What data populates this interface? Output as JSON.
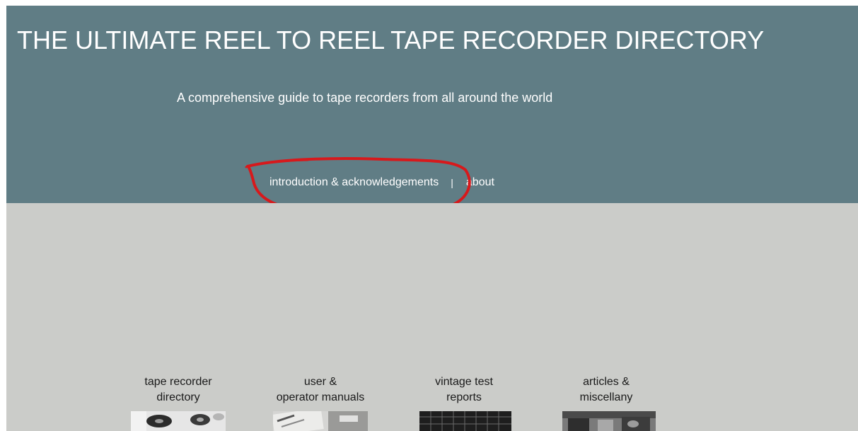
{
  "header": {
    "title": "THE ULTIMATE REEL TO REEL TAPE RECORDER DIRECTORY",
    "tagline": "A comprehensive guide to tape recorders from all around the world",
    "background_color": "#607d85"
  },
  "nav": {
    "items": [
      {
        "label": "introduction & acknowledgements"
      },
      {
        "label": "about"
      }
    ],
    "separator": "|"
  },
  "annotation": {
    "color": "#d7191c",
    "icon": "hand-drawn-circle"
  },
  "content": {
    "background_color": "#cbccc9",
    "tiles": [
      {
        "label": "tape recorder\ndirectory",
        "thumb_icon": "tape-reel-photo-thumbnail"
      },
      {
        "label": "user &\noperator manuals",
        "thumb_icon": "akai-manual-cover-thumbnail"
      },
      {
        "label": "vintage test\nreports",
        "thumb_icon": "test-report-grid-thumbnail"
      },
      {
        "label": "articles &\nmiscellany",
        "thumb_icon": "vintage-photo-thumbnail"
      }
    ]
  }
}
